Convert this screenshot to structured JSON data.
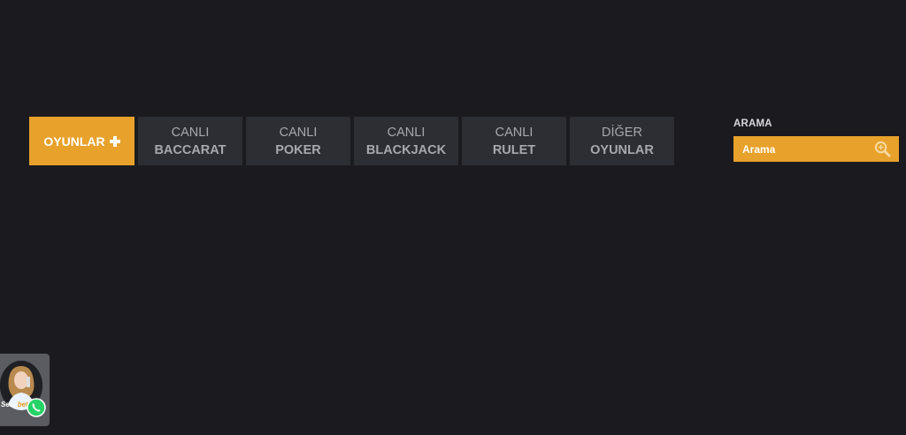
{
  "nav": {
    "active_tab": {
      "label": "OYUNLAR",
      "icon": "plus-icon"
    },
    "tabs": [
      {
        "line1": "CANLI",
        "line2": "BACCARAT"
      },
      {
        "line1": "CANLI",
        "line2": "POKER"
      },
      {
        "line1": "CANLI",
        "line2": "BLACKJACK"
      },
      {
        "line1": "CANLI",
        "line2": "RULET"
      },
      {
        "line1": "DİĞER",
        "line2": "OYUNLAR"
      }
    ]
  },
  "search": {
    "heading": "ARAMA",
    "placeholder": "Arama",
    "icon": "search-icon"
  },
  "chat_widget": {
    "avatar_label_prefix": "Seka",
    "avatar_label_suffix": "bet",
    "icon": "whatsapp-icon"
  },
  "colors": {
    "background": "#1b1b1f",
    "accent": "#e8a12a",
    "tab_bg": "#2d2e33",
    "tab_text": "#a7a8ad"
  }
}
